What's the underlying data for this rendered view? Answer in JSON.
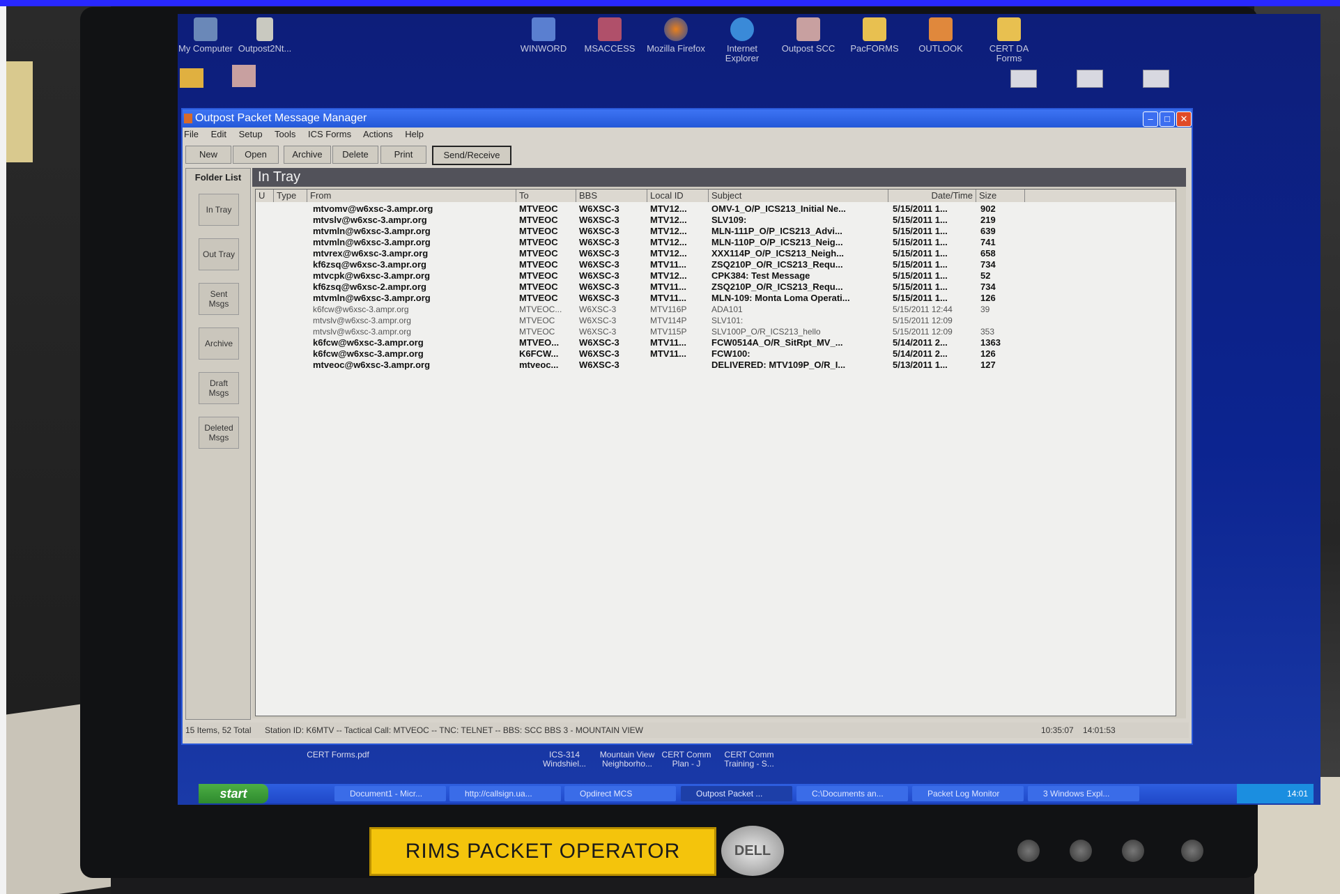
{
  "desktop": {
    "icons": [
      {
        "label": "My Computer"
      },
      {
        "label": "Outpost2Nt..."
      },
      {
        "label": "WINWORD"
      },
      {
        "label": "MSACCESS"
      },
      {
        "label": "Mozilla Firefox"
      },
      {
        "label": "Internet Explorer"
      },
      {
        "label": "Outpost SCC"
      },
      {
        "label": "PacFORMS"
      },
      {
        "label": "OUTLOOK"
      },
      {
        "label": "CERT DA Forms"
      },
      {
        "label": "CERT Forms.pdf"
      },
      {
        "label": "ICS-314 Windshiel..."
      },
      {
        "label": "Mountain View Neighborho..."
      },
      {
        "label": "CERT Comm Plan - J"
      },
      {
        "label": "CERT Comm Training - S..."
      }
    ]
  },
  "window": {
    "title": "Outpost Packet Message Manager",
    "menu": [
      "File",
      "Edit",
      "Setup",
      "Tools",
      "ICS Forms",
      "Actions",
      "Help"
    ],
    "toolbar": [
      "New",
      "Open",
      "Archive",
      "Delete",
      "Print",
      "Send/Receive"
    ],
    "folders": {
      "heading": "Folder List",
      "items": [
        "In Tray",
        "Out Tray",
        "Sent Msgs",
        "Archive",
        "Draft Msgs",
        "Deleted Msgs"
      ]
    },
    "view_title": "In Tray",
    "columns": [
      "U",
      "Type",
      "From",
      "To",
      "BBS",
      "Local ID",
      "Subject",
      "Date/Time",
      "Size"
    ],
    "messages": [
      {
        "from": "mtvomv@w6xsc-3.ampr.org",
        "to": "MTVEOC",
        "bbs": "W6XSC-3",
        "local_id": "MTV12...",
        "subject": "OMV-1_O/P_ICS213_Initial Ne...",
        "datetime": "5/15/2011 1...",
        "size": "902",
        "read": false
      },
      {
        "from": "mtvslv@w6xsc-3.ampr.org",
        "to": "MTVEOC",
        "bbs": "W6XSC-3",
        "local_id": "MTV12...",
        "subject": "SLV109:",
        "datetime": "5/15/2011 1...",
        "size": "219",
        "read": false
      },
      {
        "from": "mtvmln@w6xsc-3.ampr.org",
        "to": "MTVEOC",
        "bbs": "W6XSC-3",
        "local_id": "MTV12...",
        "subject": "MLN-111P_O/P_ICS213_Advi...",
        "datetime": "5/15/2011 1...",
        "size": "639",
        "read": false
      },
      {
        "from": "mtvmln@w6xsc-3.ampr.org",
        "to": "MTVEOC",
        "bbs": "W6XSC-3",
        "local_id": "MTV12...",
        "subject": "MLN-110P_O/P_ICS213_Neig...",
        "datetime": "5/15/2011 1...",
        "size": "741",
        "read": false
      },
      {
        "from": "mtvrex@w6xsc-3.ampr.org",
        "to": "MTVEOC",
        "bbs": "W6XSC-3",
        "local_id": "MTV12...",
        "subject": "XXX114P_O/P_ICS213_Neigh...",
        "datetime": "5/15/2011 1...",
        "size": "658",
        "read": false
      },
      {
        "from": "kf6zsq@w6xsc-3.ampr.org",
        "to": "MTVEOC",
        "bbs": "W6XSC-3",
        "local_id": "MTV11...",
        "subject": "ZSQ210P_O/R_ICS213_Requ...",
        "datetime": "5/15/2011 1...",
        "size": "734",
        "read": false
      },
      {
        "from": "mtvcpk@w6xsc-3.ampr.org",
        "to": "MTVEOC",
        "bbs": "W6XSC-3",
        "local_id": "MTV12...",
        "subject": "CPK384: Test Message",
        "datetime": "5/15/2011 1...",
        "size": "52",
        "read": false
      },
      {
        "from": "kf6zsq@w6xsc-2.ampr.org",
        "to": "MTVEOC",
        "bbs": "W6XSC-3",
        "local_id": "MTV11...",
        "subject": "ZSQ210P_O/R_ICS213_Requ...",
        "datetime": "5/15/2011 1...",
        "size": "734",
        "read": false
      },
      {
        "from": "mtvmln@w6xsc-3.ampr.org",
        "to": "MTVEOC",
        "bbs": "W6XSC-3",
        "local_id": "MTV11...",
        "subject": "MLN-109: Monta Loma Operati...",
        "datetime": "5/15/2011 1...",
        "size": "126",
        "read": false
      },
      {
        "from": "k6fcw@w6xsc-3.ampr.org",
        "to": "MTVEOC...",
        "bbs": "W6XSC-3",
        "local_id": "MTV116P",
        "subject": "ADA101",
        "datetime": "5/15/2011 12:44",
        "size": "39",
        "read": true
      },
      {
        "from": "mtvslv@w6xsc-3.ampr.org",
        "to": "MTVEOC",
        "bbs": "W6XSC-3",
        "local_id": "MTV114P",
        "subject": "SLV101:",
        "datetime": "5/15/2011 12:09",
        "size": "",
        "read": true
      },
      {
        "from": "mtvslv@w6xsc-3.ampr.org",
        "to": "MTVEOC",
        "bbs": "W6XSC-3",
        "local_id": "MTV115P",
        "subject": "SLV100P_O/R_ICS213_hello",
        "datetime": "5/15/2011 12:09",
        "size": "353",
        "read": true
      },
      {
        "from": "k6fcw@w6xsc-3.ampr.org",
        "to": "MTVEO...",
        "bbs": "W6XSC-3",
        "local_id": "MTV11...",
        "subject": "FCW0514A_O/R_SitRpt_MV_...",
        "datetime": "5/14/2011 2...",
        "size": "1363",
        "read": false
      },
      {
        "from": "k6fcw@w6xsc-3.ampr.org",
        "to": "K6FCW...",
        "bbs": "W6XSC-3",
        "local_id": "MTV11...",
        "subject": "FCW100:",
        "datetime": "5/14/2011 2...",
        "size": "126",
        "read": false
      },
      {
        "from": "mtveoc@w6xsc-3.ampr.org",
        "to": "mtveoc...",
        "bbs": "W6XSC-3",
        "local_id": "",
        "subject": "DELIVERED: MTV109P_O/R_I...",
        "datetime": "5/13/2011 1...",
        "size": "127",
        "read": false
      }
    ],
    "status": {
      "counts": "15 Items, 52 Total",
      "station": "Station ID: K6MTV -- Tactical Call: MTVEOC -- TNC: TELNET -- BBS: SCC BBS 3 - MOUNTAIN VIEW",
      "time1": "10:35:07",
      "time2": "14:01:53"
    }
  },
  "taskbar": {
    "start": "start",
    "items": [
      "Document1 - Micr...",
      "http://callsign.ua...",
      "Opdirect MCS",
      "Outpost Packet ...",
      "C:\\Documents an...",
      "Packet Log Monitor",
      "3 Windows Expl..."
    ],
    "clock": "14:01"
  },
  "monitor": {
    "label": "RIMS PACKET OPERATOR",
    "brand": "DELL"
  }
}
